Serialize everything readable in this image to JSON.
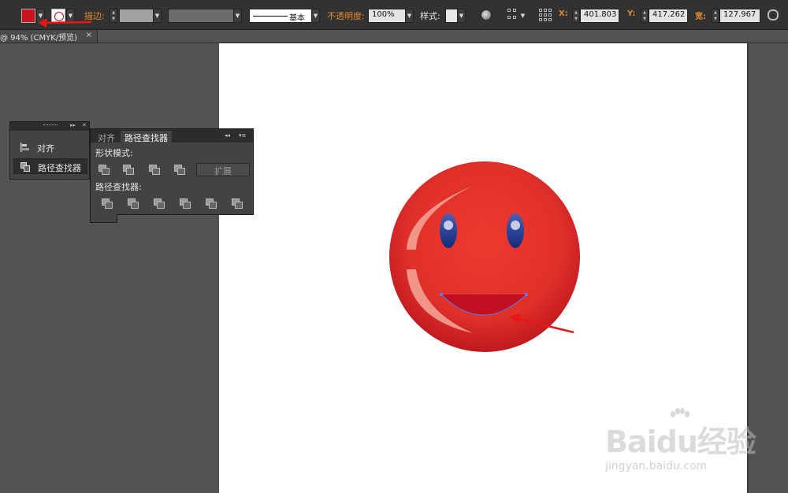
{
  "document_tab": {
    "title": "@ 94% (CMYK/预览)",
    "close": "×"
  },
  "control_bar": {
    "stroke_label": "描边:",
    "brush_label": "基本",
    "opacity_label": "不透明度:",
    "opacity_value": "100%",
    "style_label": "样式:",
    "x_label": "X:",
    "x_value": "401.803",
    "y_label": "Y:",
    "y_value": "417.262",
    "w_label": "宽:",
    "w_value": "127.967",
    "fill_color": "#c8141e"
  },
  "align_panel": {
    "items": [
      {
        "label": "对齐",
        "icon": "align-icon"
      },
      {
        "label": "路径查找器",
        "icon": "pathfinder-icon"
      }
    ]
  },
  "pathfinder_panel": {
    "tabs": [
      "对齐",
      "路径查找器"
    ],
    "shape_modes_label": "形状模式:",
    "pathfinders_label": "路径查找器:",
    "expand_label": "扩展"
  },
  "watermark": {
    "brand": "Baidu经验",
    "url": "jingyan.baidu.com"
  }
}
